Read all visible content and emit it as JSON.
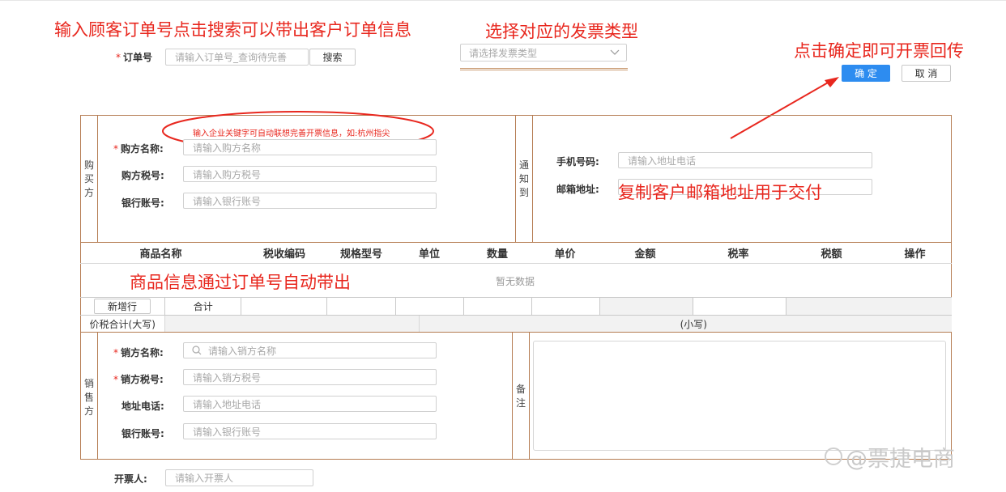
{
  "annotations": {
    "order_search_note": "输入顾客订单号点击搜索可以带出客户订单信息",
    "invoice_type_note": "选择对应的发票类型",
    "confirm_note": "点击确定即可开票回传",
    "keyword_note": "输入企业关键字可自动联想完善开票信息，如:杭州指尖",
    "email_note": "复制客户邮箱地址用于交付",
    "goods_note": "商品信息通过订单号自动带出"
  },
  "order": {
    "label": "订单号",
    "placeholder": "请输入订单号_查询待完善",
    "search_label": "搜索"
  },
  "invoice_type": {
    "placeholder": "请选择发票类型",
    "icon": "chevron-down-icon"
  },
  "actions": {
    "confirm_label": "确 定",
    "cancel_label": "取 消"
  },
  "buyer": {
    "section_label": [
      "购",
      "买",
      "方"
    ],
    "name_label": "购方名称:",
    "name_placeholder": "请输入购方名称",
    "tax_label": "购方税号:",
    "tax_placeholder": "请输入购方税号",
    "bank_label": "银行账号:",
    "bank_placeholder": "请输入银行账号"
  },
  "notify": {
    "section_label": [
      "通",
      "知",
      "到"
    ],
    "phone_label": "手机号码:",
    "phone_placeholder": "请输入地址电话",
    "email_label": "邮箱地址:"
  },
  "table": {
    "headers": [
      "商品名称",
      "税收编码",
      "规格型号",
      "单位",
      "数量",
      "单价",
      "金额",
      "税率",
      "税额",
      "操作"
    ],
    "empty_text": "暂无数据",
    "add_row_label": "新增行",
    "total_label": "合计",
    "total_upper_label": "价税合计(大写)",
    "total_lower_label": "(小写)"
  },
  "seller": {
    "section_label": [
      "销",
      "售",
      "方"
    ],
    "name_label": "销方名称:",
    "name_placeholder": "请输入销方名称",
    "tax_label": "销方税号:",
    "tax_placeholder": "请输入销方税号",
    "addr_label": "地址电话:",
    "addr_placeholder": "请输入地址电话",
    "bank_label": "银行账号:",
    "bank_placeholder": "请输入银行账号"
  },
  "remark": {
    "section_label": [
      "备",
      "注"
    ]
  },
  "issuer": {
    "label": "开票人:",
    "placeholder": "请输入开票人"
  },
  "watermark": "@票捷电商",
  "colors": {
    "annotation_red": "#e8271e",
    "primary_blue": "#2d8cf0",
    "frame_brown": "#b57c52"
  }
}
